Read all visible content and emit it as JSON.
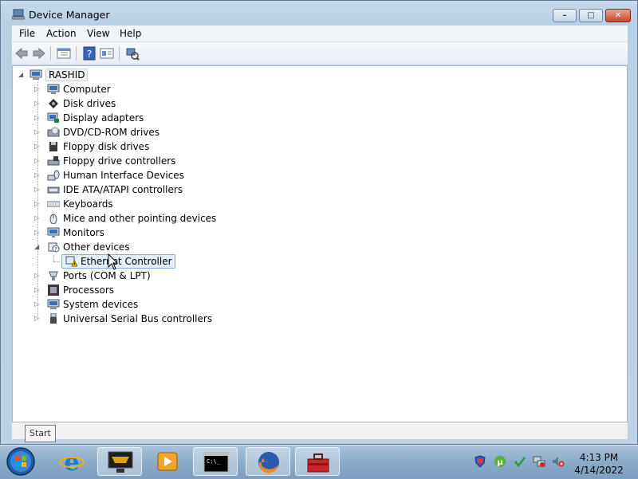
{
  "window": {
    "title": "Device Manager",
    "controls": {
      "minimize": "–",
      "maximize": "□",
      "close": "✕"
    }
  },
  "menu": [
    "File",
    "Action",
    "View",
    "Help"
  ],
  "toolbar": {
    "icons": [
      "back-arrow-icon",
      "forward-arrow-icon",
      "properties-pane-icon",
      "help-icon",
      "update-driver-icon",
      "scan-hardware-icon"
    ]
  },
  "tree": {
    "root": "RASHID",
    "categories": [
      {
        "label": "Computer",
        "icon": "computer-icon",
        "expanded": false
      },
      {
        "label": "Disk drives",
        "icon": "disk-drive-icon",
        "expanded": false
      },
      {
        "label": "Display adapters",
        "icon": "display-adapter-icon",
        "expanded": false
      },
      {
        "label": "DVD/CD-ROM drives",
        "icon": "dvd-drive-icon",
        "expanded": false
      },
      {
        "label": "Floppy disk drives",
        "icon": "floppy-disk-icon",
        "expanded": false
      },
      {
        "label": "Floppy drive controllers",
        "icon": "floppy-controller-icon",
        "expanded": false
      },
      {
        "label": "Human Interface Devices",
        "icon": "hid-icon",
        "expanded": false
      },
      {
        "label": "IDE ATA/ATAPI controllers",
        "icon": "ide-controller-icon",
        "expanded": false
      },
      {
        "label": "Keyboards",
        "icon": "keyboard-icon",
        "expanded": false
      },
      {
        "label": "Mice and other pointing devices",
        "icon": "mouse-icon",
        "expanded": false
      },
      {
        "label": "Monitors",
        "icon": "monitor-icon",
        "expanded": false
      },
      {
        "label": "Other devices",
        "icon": "unknown-device-icon",
        "expanded": true,
        "children": [
          {
            "label": "Ethernet Controller",
            "icon": "warning-device-icon",
            "selected": true
          }
        ]
      },
      {
        "label": "Ports (COM & LPT)",
        "icon": "port-icon",
        "expanded": false
      },
      {
        "label": "Processors",
        "icon": "processor-icon",
        "expanded": false
      },
      {
        "label": "System devices",
        "icon": "system-device-icon",
        "expanded": false
      },
      {
        "label": "Universal Serial Bus controllers",
        "icon": "usb-icon",
        "expanded": false
      }
    ]
  },
  "taskbar": {
    "start_tooltip": "Start",
    "apps": [
      "internet-explorer-icon",
      "app-monitor-icon",
      "media-player-icon",
      "command-prompt-icon",
      "firefox-icon",
      "toolbox-icon"
    ],
    "tray_icons": [
      "security-shield-icon",
      "utorrent-icon",
      "volume-check-icon",
      "network-icon",
      "speaker-muted-icon"
    ],
    "clock": {
      "time": "4:13 PM",
      "date": "4/14/2022"
    }
  },
  "colors": {
    "selection": "#e3eefb",
    "selection_border": "#84acdd",
    "window_frame": "#bcd1e7"
  }
}
